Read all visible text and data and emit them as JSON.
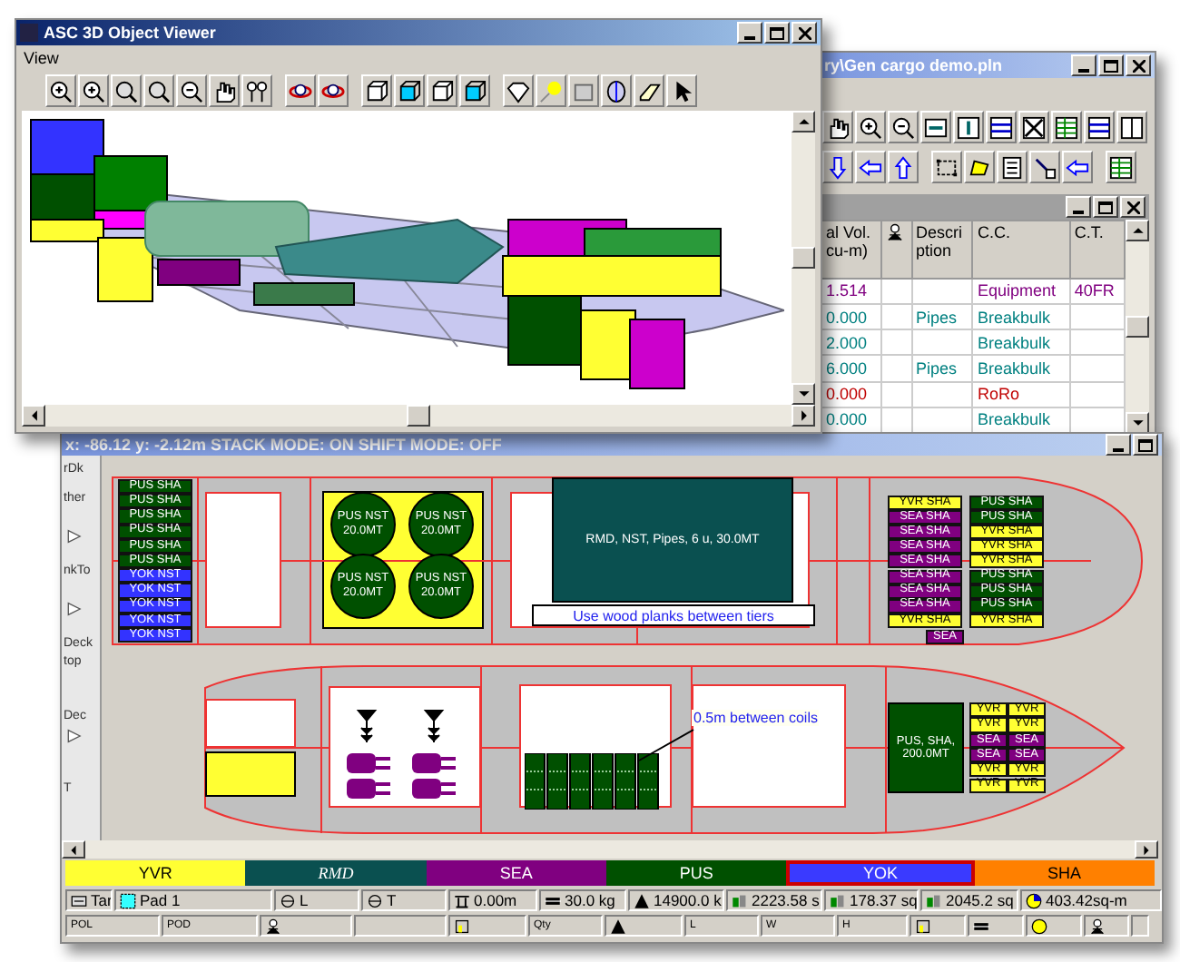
{
  "back_window": {
    "title": "ry\\Gen cargo demo.pln",
    "table": {
      "columns": [
        {
          "kind": "text",
          "label": "al Vol.\ncu-m)"
        },
        {
          "kind": "icon"
        },
        {
          "kind": "text",
          "label": "Descri\nption"
        },
        {
          "kind": "text",
          "label": "C.C."
        },
        {
          "kind": "text",
          "label": "C.T."
        }
      ],
      "rows": [
        {
          "volume": "1.514",
          "cc": "Equipment",
          "ct": "40FR",
          "color": "#800080"
        },
        {
          "volume": "0.000",
          "description": "Pipes",
          "cc": "Breakbulk",
          "color": "#008080"
        },
        {
          "volume": "2.000",
          "cc": "Breakbulk",
          "color": "#008080"
        },
        {
          "volume": "6.000",
          "description": "Pipes",
          "cc": "Breakbulk",
          "color": "#008080"
        },
        {
          "volume": "0.000",
          "cc": "RoRo",
          "color": "#c00000"
        },
        {
          "volume": "0.000",
          "cc": "Breakbulk",
          "color": "#008080"
        }
      ]
    }
  },
  "viewer_window": {
    "title": "ASC 3D Object Viewer",
    "menu": [
      "View"
    ]
  },
  "main_window": {
    "title": "x: -86.12   y: -2.12m STACK MODE: ON   SHIFT MODE: OFF",
    "ruler_labels": [
      "rDk",
      "ther",
      "nkTo",
      "Deck",
      "top",
      "Dec",
      "T"
    ],
    "upper_deck": {
      "stacks": [
        {
          "blocks": [
            {
              "label": "PUS SHA",
              "color": "#005000"
            },
            {
              "label": "PUS SHA",
              "color": "#005000"
            },
            {
              "label": "PUS SHA",
              "color": "#005000"
            },
            {
              "label": "PUS SHA",
              "color": "#005000"
            },
            {
              "label": "PUS SHA",
              "color": "#005000"
            },
            {
              "label": "PUS SHA",
              "color": "#005000"
            },
            {
              "label": "YOK NST",
              "color": "#3333ff"
            },
            {
              "label": "YOK NST",
              "color": "#3333ff"
            },
            {
              "label": "YOK NST",
              "color": "#3333ff"
            },
            {
              "label": "YOK NST",
              "color": "#3333ff"
            },
            {
              "label": "YOK NST",
              "color": "#3333ff"
            }
          ]
        },
        {
          "blocks": [
            {
              "label": "YVR SHA",
              "color": "#ffff33"
            },
            {
              "label": "SEA SHA",
              "color": "#800080"
            },
            {
              "label": "SEA SHA",
              "color": "#800080"
            },
            {
              "label": "SEA SHA",
              "color": "#800080"
            },
            {
              "label": "SEA SHA",
              "color": "#800080"
            },
            {
              "label": "SEA SHA",
              "color": "#800080"
            },
            {
              "label": "SEA SHA",
              "color": "#800080"
            },
            {
              "label": "SEA SHA",
              "color": "#800080"
            },
            {
              "label": "YVR SHA",
              "color": "#ffff33"
            }
          ]
        },
        {
          "blocks": [
            {
              "label": "PUS SHA",
              "color": "#005000"
            },
            {
              "label": "PUS SHA",
              "color": "#005000"
            },
            {
              "label": "YVR SHA",
              "color": "#ffff33"
            },
            {
              "label": "YVR SHA",
              "color": "#ffff33"
            },
            {
              "label": "YVR SHA",
              "color": "#ffff33"
            },
            {
              "label": "PUS SHA",
              "color": "#005000"
            },
            {
              "label": "PUS SHA",
              "color": "#005000"
            },
            {
              "label": "PUS SHA",
              "color": "#005000"
            },
            {
              "label": "YVR SHA",
              "color": "#ffff33"
            }
          ]
        },
        {
          "blocks": [
            {
              "label": "SEA",
              "color": "#800080"
            }
          ]
        }
      ],
      "coils": [
        {
          "label": "PUS NST 20.0MT"
        },
        {
          "label": "PUS NST 20.0MT"
        },
        {
          "label": "PUS NST 20.0MT"
        },
        {
          "label": "PUS NST 20.0MT"
        }
      ],
      "hatch_cargo": "RMD, NST, Pipes, 6 u, 30.0MT",
      "note": "Use wood planks between tiers"
    },
    "lower_deck": {
      "stacks": [
        {
          "blocks": [
            {
              "label": "YVR",
              "color": "#ffff33"
            },
            {
              "label": "YVR",
              "color": "#ffff33"
            },
            {
              "label": "SEA",
              "color": "#800080"
            },
            {
              "label": "SEA",
              "color": "#800080"
            },
            {
              "label": "YVR",
              "color": "#ffff33"
            },
            {
              "label": "YVR",
              "color": "#ffff33"
            }
          ]
        },
        {
          "blocks": [
            {
              "label": "YVR",
              "color": "#ffff33"
            },
            {
              "label": "YVR",
              "color": "#ffff33"
            },
            {
              "label": "SEA",
              "color": "#800080"
            },
            {
              "label": "SEA",
              "color": "#800080"
            },
            {
              "label": "YVR",
              "color": "#ffff33"
            },
            {
              "label": "YVR",
              "color": "#ffff33"
            }
          ]
        }
      ],
      "bulk_cargo": "PUS, SHA, 200.0MT",
      "note": "0.5m between coils"
    },
    "legend": [
      {
        "label": "YVR",
        "color": "#ffff33",
        "selected": false
      },
      {
        "label": "RMD",
        "color": "#0a5050",
        "selected": false
      },
      {
        "label": "SEA",
        "color": "#800080",
        "selected": false
      },
      {
        "label": "PUS",
        "color": "#005000",
        "selected": false
      },
      {
        "label": "YOK",
        "color": "#3a3aff",
        "selected": true
      },
      {
        "label": "SHA",
        "color": "#ff8000",
        "selected": false
      }
    ],
    "status_bar": [
      "Tar",
      "Pad 1",
      "L",
      "T",
      "0.00m",
      "30.0 kg",
      "14900.0 k",
      "2223.58 s",
      "178.37 sq",
      "2045.2 sq",
      "403.42sq-m"
    ],
    "status_bar_2": [
      "POL",
      "POD",
      "Qty",
      "L",
      "W",
      "H"
    ]
  }
}
